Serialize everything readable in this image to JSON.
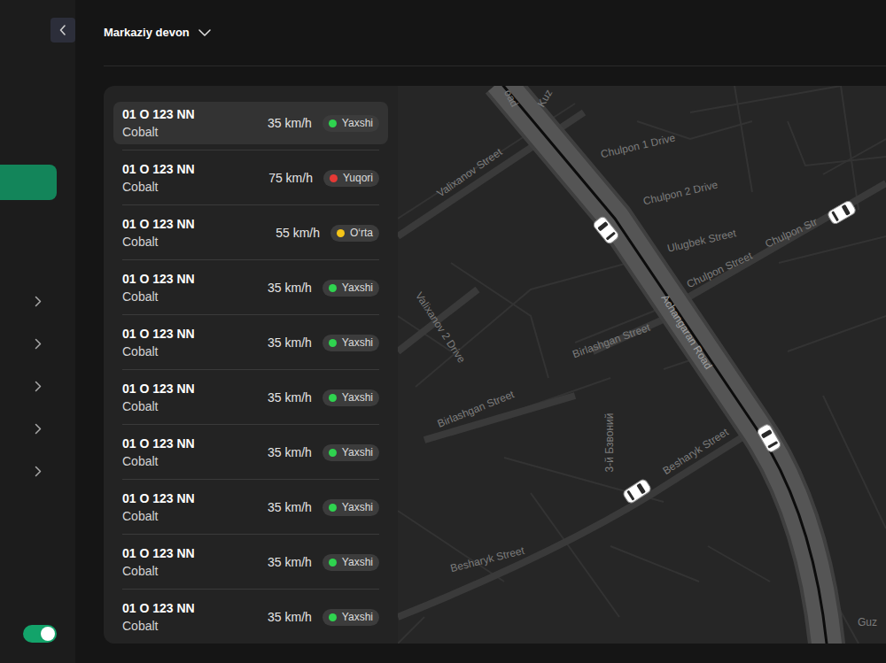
{
  "header": {
    "title": "Markaziy devon"
  },
  "sidebar": {
    "items": [
      {
        "kind": "link",
        "selected": true
      },
      {
        "kind": "group",
        "selected": false,
        "expanded": false
      },
      {
        "kind": "group",
        "selected": false,
        "expanded": false
      },
      {
        "kind": "group",
        "selected": false,
        "expanded": false
      },
      {
        "kind": "group",
        "selected": false,
        "expanded": false
      },
      {
        "kind": "group",
        "selected": false,
        "expanded": false
      }
    ]
  },
  "toggle": {
    "on": true
  },
  "vehicles": [
    {
      "plate": "01 O 123 NN",
      "model": "Cobalt",
      "speed": "35 km/h",
      "status": "Yaxshi",
      "color": "#2fd34f",
      "selected": true
    },
    {
      "plate": "01 O 123 NN",
      "model": "Cobalt",
      "speed": "75 km/h",
      "status": "Yuqori",
      "color": "#e53935",
      "selected": false
    },
    {
      "plate": "01 O 123 NN",
      "model": "Cobalt",
      "speed": "55 km/h",
      "status": "O‘rta",
      "color": "#f5c518",
      "selected": false
    },
    {
      "plate": "01 O 123 NN",
      "model": "Cobalt",
      "speed": "35 km/h",
      "status": "Yaxshi",
      "color": "#2fd34f",
      "selected": false
    },
    {
      "plate": "01 O 123 NN",
      "model": "Cobalt",
      "speed": "35 km/h",
      "status": "Yaxshi",
      "color": "#2fd34f",
      "selected": false
    },
    {
      "plate": "01 O 123 NN",
      "model": "Cobalt",
      "speed": "35 km/h",
      "status": "Yaxshi",
      "color": "#2fd34f",
      "selected": false
    },
    {
      "plate": "01 O 123 NN",
      "model": "Cobalt",
      "speed": "35 km/h",
      "status": "Yaxshi",
      "color": "#2fd34f",
      "selected": false
    },
    {
      "plate": "01 O 123 NN",
      "model": "Cobalt",
      "speed": "35 km/h",
      "status": "Yaxshi",
      "color": "#2fd34f",
      "selected": false
    },
    {
      "plate": "01 O 123 NN",
      "model": "Cobalt",
      "speed": "35 km/h",
      "status": "Yaxshi",
      "color": "#2fd34f",
      "selected": false
    },
    {
      "plate": "01 O 123 NN",
      "model": "Cobalt",
      "speed": "35 km/h",
      "status": "Yaxshi",
      "color": "#2fd34f",
      "selected": false
    }
  ],
  "map": {
    "labels": [
      "oad",
      "Kuz",
      "Valixanov Street",
      "Chulpon 1 Drive",
      "Chulpon 2 Drive",
      "Ulugbek Street",
      "Chulpon Street",
      "Chulpon Str",
      "Achangaran Road",
      "Valixanov 2 Drive",
      "Birlashgan Street",
      "Birlashgan Street",
      "3-й Бзвоний",
      "Besharyk Street",
      "Besharyk Street",
      "Guz"
    ]
  }
}
